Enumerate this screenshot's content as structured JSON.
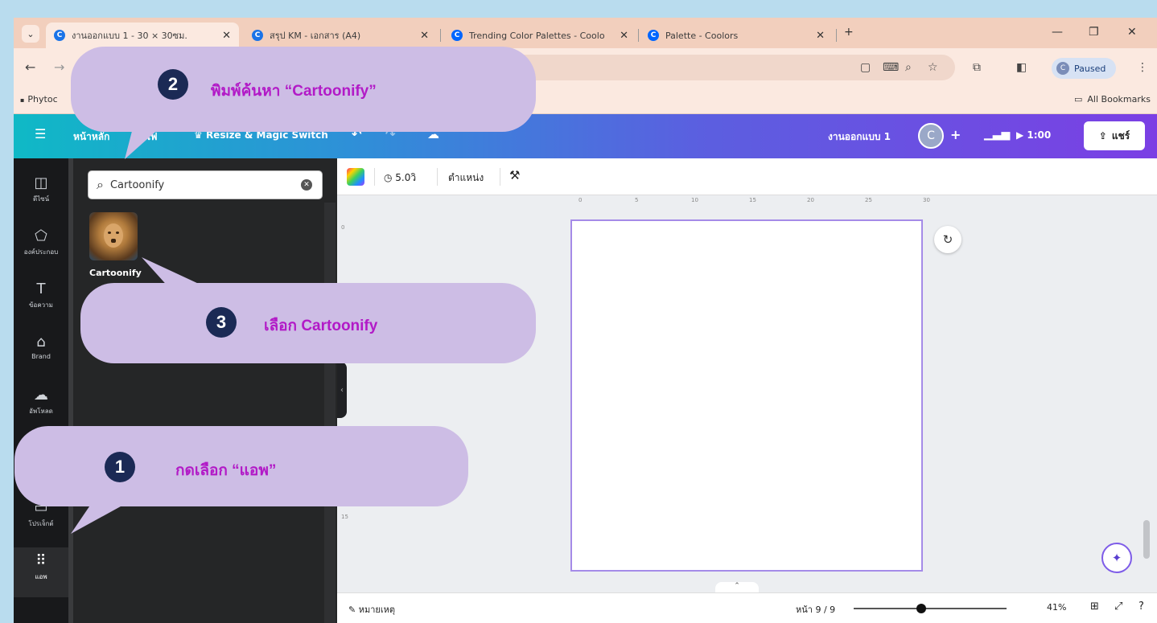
{
  "browser": {
    "tabs": [
      {
        "title": "งานออกแบบ 1 - 30 × 30ซม.",
        "active": true
      },
      {
        "title": "สรุป KM - เอกสาร (A4)",
        "active": false
      },
      {
        "title": "Trending Color Palettes - Coolo",
        "active": false
      },
      {
        "title": "Palette - Coolors",
        "active": false
      }
    ],
    "new_tab": "+",
    "profile_label": "Paused",
    "profile_initial": "C",
    "bookmark_left": "Phytoc",
    "bookmark_right": "All Bookmarks"
  },
  "canva": {
    "header": {
      "home": "หน้าหลัก",
      "file": "ไฟ",
      "resize": "Resize & Magic Switch",
      "design_title": "งานออกแบบ 1",
      "avatar": "C",
      "add": "+",
      "timer": "1:00",
      "share": "แชร์"
    },
    "rail": [
      {
        "icon": "layout-icon",
        "label": "ดีไซน์"
      },
      {
        "icon": "elements-icon",
        "label": "องค์ประกอบ"
      },
      {
        "icon": "text-icon",
        "label": "ข้อความ"
      },
      {
        "icon": "brand-icon",
        "label": "Brand"
      },
      {
        "icon": "upload-icon",
        "label": "อัพโหลด"
      },
      {
        "icon": "projects-icon",
        "label": "โปรเจ็กต์"
      },
      {
        "icon": "apps-icon",
        "label": "แอพ"
      }
    ],
    "panel": {
      "search_value": "Cartoonify",
      "result_label": "Cartoonify"
    },
    "context_bar": {
      "duration": "5.0วิ",
      "position": "ตำแหน่ง"
    },
    "ruler_ticks": [
      "0",
      "5",
      "10",
      "15",
      "20",
      "25",
      "30"
    ],
    "ruler_left_ticks": [
      "0",
      "15"
    ],
    "footer": {
      "notes": "หมายเหตุ",
      "page": "หน้า 9 / 9",
      "zoom": "41%",
      "zoom_fraction": 0.41
    }
  },
  "callouts": [
    {
      "number": "2",
      "text": "พิมพ์ค้นหา “Cartoonify”"
    },
    {
      "number": "3",
      "text": "เลือก Cartoonify"
    },
    {
      "number": "1",
      "text": "กดเลือก “แอพ”"
    }
  ]
}
